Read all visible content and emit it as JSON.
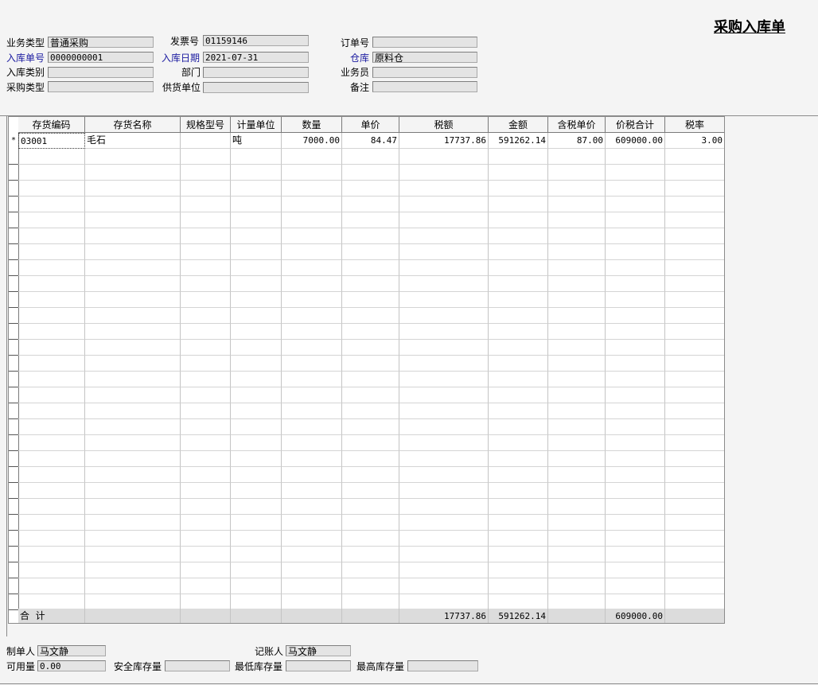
{
  "form_title": "采购入库单",
  "header": {
    "business_type": {
      "label": "业务类型",
      "value": "普通采购"
    },
    "invoice_no": {
      "label": "发票号",
      "value": "01159146"
    },
    "order_no": {
      "label": "订单号",
      "value": ""
    },
    "receipt_no": {
      "label": "入库单号",
      "value": "0000000001"
    },
    "receipt_date": {
      "label": "入库日期",
      "value": "2021-07-31"
    },
    "warehouse": {
      "label": "仓库",
      "value": "原料仓"
    },
    "receipt_category": {
      "label": "入库类别",
      "value": ""
    },
    "department": {
      "label": "部门",
      "value": ""
    },
    "salesperson": {
      "label": "业务员",
      "value": ""
    },
    "purchase_type": {
      "label": "采购类型",
      "value": ""
    },
    "supplier": {
      "label": "供货单位",
      "value": ""
    },
    "remark": {
      "label": "备注",
      "value": ""
    }
  },
  "grid": {
    "columns": [
      "存货编码",
      "存货名称",
      "规格型号",
      "计量单位",
      "数量",
      "单价",
      "税额",
      "金额",
      "含税单价",
      "价税合计",
      "税率"
    ],
    "rows": [
      {
        "marker": "*",
        "code": "03001",
        "name": "毛石",
        "spec": "",
        "unit": "吨",
        "qty": "7000.00",
        "price": "84.47",
        "tax": "17737.86",
        "amount": "591262.14",
        "tax_price": "87.00",
        "total": "609000.00",
        "tax_rate": "3.00"
      }
    ],
    "totals": {
      "label": "合  计",
      "tax": "17737.86",
      "amount": "591262.14",
      "total": "609000.00"
    }
  },
  "footer": {
    "maker": {
      "label": "制单人",
      "value": "马文静"
    },
    "bookkeeper": {
      "label": "记账人",
      "value": "马文静"
    },
    "available_qty": {
      "label": "可用量",
      "value": "0.00"
    },
    "safety_stock": {
      "label": "安全库存量",
      "value": ""
    },
    "min_stock": {
      "label": "最低库存量",
      "value": ""
    },
    "max_stock": {
      "label": "最高库存量",
      "value": ""
    }
  }
}
